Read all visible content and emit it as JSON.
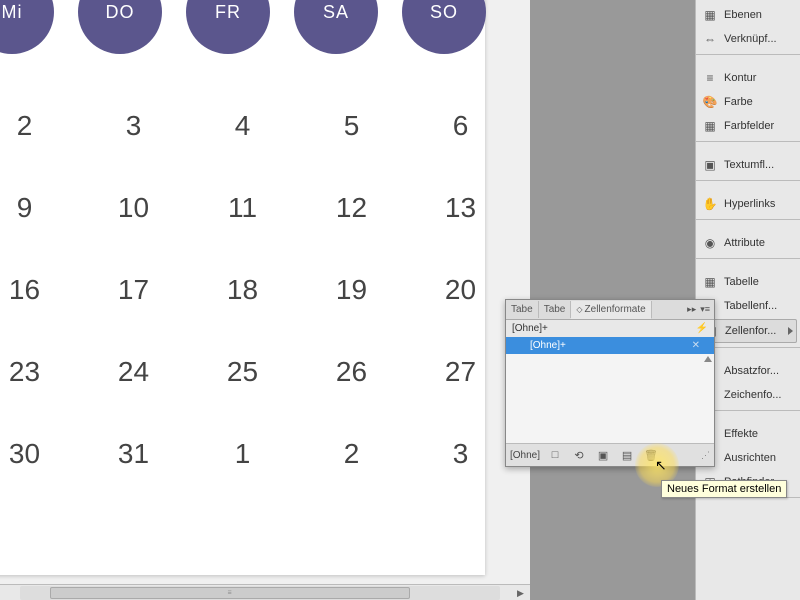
{
  "calendar": {
    "days": [
      "Mi",
      "DO",
      "FR",
      "SA",
      "SO"
    ],
    "rows": [
      [
        "2",
        "3",
        "4",
        "5",
        "6"
      ],
      [
        "9",
        "10",
        "11",
        "12",
        "13"
      ],
      [
        "16",
        "17",
        "18",
        "19",
        "20"
      ],
      [
        "23",
        "24",
        "25",
        "26",
        "27"
      ],
      [
        "30",
        "31",
        "1",
        "2",
        "3"
      ]
    ]
  },
  "rail": {
    "g0": [
      "Ebenen",
      "Verknüpf..."
    ],
    "g1": [
      "Kontur",
      "Farbe",
      "Farbfelder"
    ],
    "g2": [
      "Textumfl..."
    ],
    "g3": [
      "Hyperlinks"
    ],
    "g4": [
      "Attribute"
    ],
    "g5": [
      "Tabelle",
      "Tabellenf...",
      "Zellenfor..."
    ],
    "g6": [
      "Absatzfor...",
      "Zeichenfo..."
    ],
    "g7": [
      "Effekte",
      "Ausrichten",
      "Pathfinder"
    ]
  },
  "panel": {
    "tabs": [
      "Tabe",
      "Tabe",
      "Zellenformate"
    ],
    "row1": "[Ohne]+",
    "selected": "[Ohne]+",
    "footer_label": "[Ohne]",
    "ctrl_dbl": "▸▸",
    "ctrl_menu": "▾≡"
  },
  "tooltip": "Neues Format erstellen"
}
